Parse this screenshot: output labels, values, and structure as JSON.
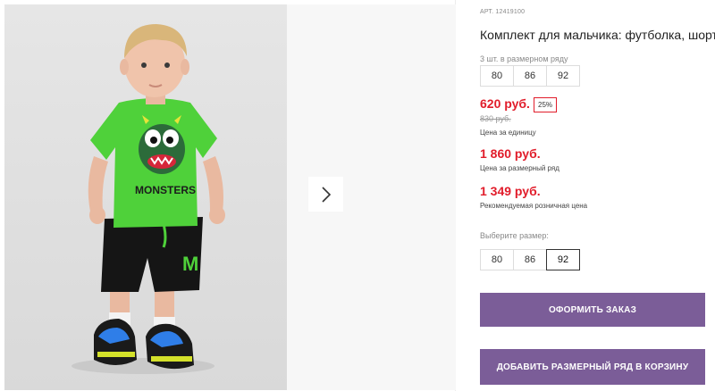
{
  "product": {
    "sku": "АРТ. 12419100",
    "title": "Комплект для мальчика: футболка, шорты",
    "set_note": "3 шт. в размерном ряду",
    "set_sizes": [
      "80",
      "86",
      "92"
    ],
    "price": "620 руб.",
    "discount": "25%",
    "old_price": "830 руб.",
    "price_caption": "Цена за единицу",
    "set_price": "1 860 руб.",
    "set_price_caption": "Цена за размерный ряд",
    "rrp_price": "1 349 руб.",
    "rrp_caption": "Рекомендуемая розничная цена",
    "size_label": "Выберите размер:",
    "pick_sizes": [
      "80",
      "86",
      "92"
    ],
    "selected_size": "92",
    "order_button": "ОФОРМИТЬ ЗАКАЗ",
    "cart_button": "ДОБАВИТЬ РАЗМЕРНЫЙ РЯД В КОРЗИНУ",
    "print_text": "MONSTERS"
  },
  "colors": {
    "accent": "#7b5d98",
    "price_red": "#e11d2b",
    "shirt_green": "#4fd13a"
  },
  "icons": {
    "next": "chevron-right-icon"
  }
}
